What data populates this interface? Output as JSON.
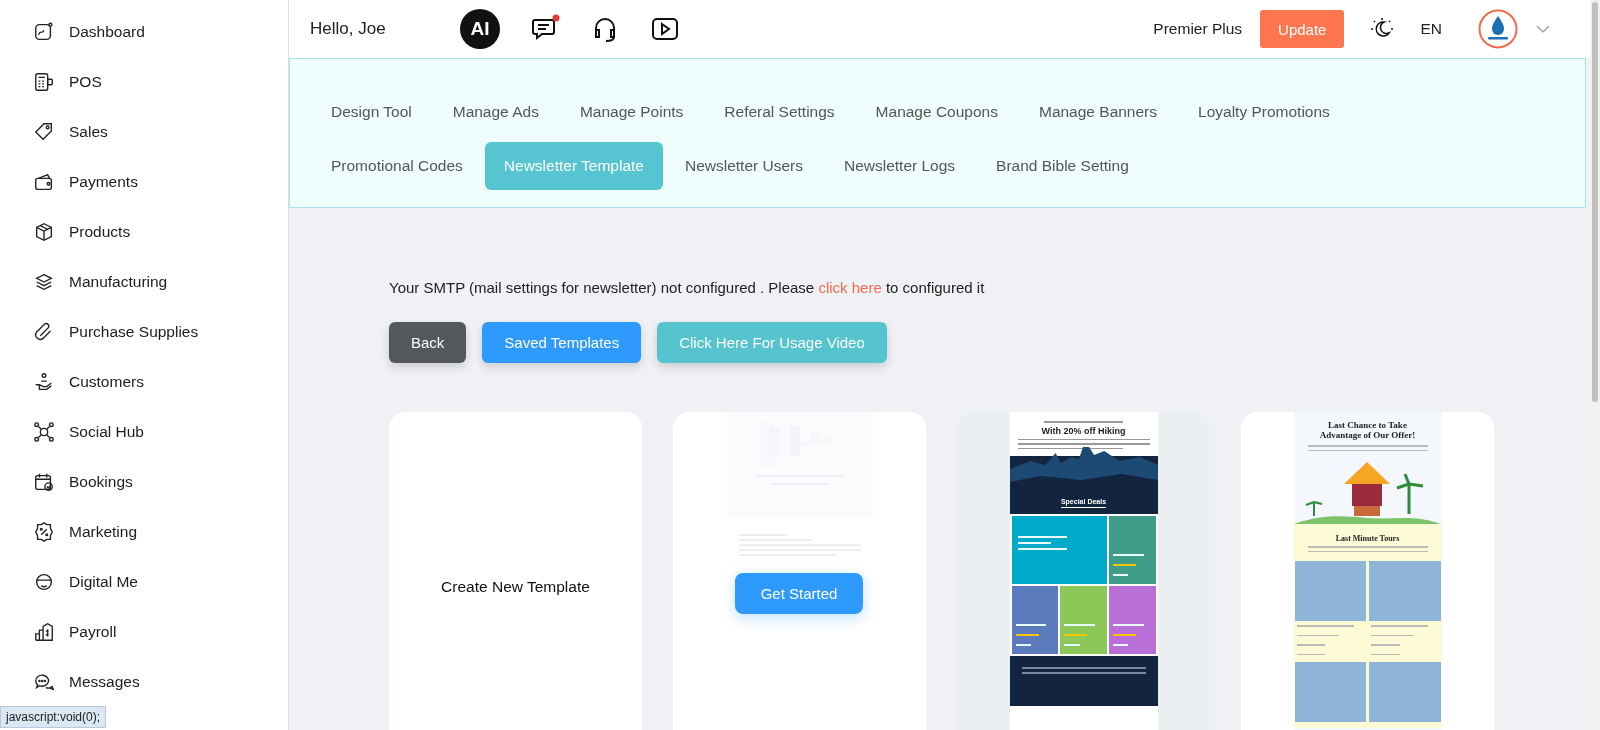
{
  "header": {
    "greeting": "Hello, Joe",
    "ai_badge": "AI",
    "chat_unread": true,
    "plan": "Premier Plus",
    "update_button": "Update",
    "language": "EN"
  },
  "sidebar": {
    "items": [
      {
        "label": "Dashboard"
      },
      {
        "label": "POS"
      },
      {
        "label": "Sales"
      },
      {
        "label": "Payments"
      },
      {
        "label": "Products"
      },
      {
        "label": "Manufacturing"
      },
      {
        "label": "Purchase Supplies"
      },
      {
        "label": "Customers"
      },
      {
        "label": "Social Hub"
      },
      {
        "label": "Bookings"
      },
      {
        "label": "Marketing"
      },
      {
        "label": "Digital Me"
      },
      {
        "label": "Payroll"
      },
      {
        "label": "Messages"
      }
    ]
  },
  "tabs": [
    {
      "label": "Design Tool",
      "selected": false
    },
    {
      "label": "Manage Ads",
      "selected": false
    },
    {
      "label": "Manage Points",
      "selected": false
    },
    {
      "label": "Referal Settings",
      "selected": false
    },
    {
      "label": "Manage Coupons",
      "selected": false
    },
    {
      "label": "Manage Banners",
      "selected": false
    },
    {
      "label": "Loyalty Promotions",
      "selected": false
    },
    {
      "label": "Promotional Codes",
      "selected": false
    },
    {
      "label": "Newsletter Template",
      "selected": true
    },
    {
      "label": "Newsletter Users",
      "selected": false
    },
    {
      "label": "Newsletter Logs",
      "selected": false
    },
    {
      "label": "Brand Bible Setting",
      "selected": false
    }
  ],
  "notice": {
    "before": "Your SMTP (mail settings for newsletter) not configured . Please ",
    "link": "click here",
    "after": " to configured it"
  },
  "buttons": [
    {
      "label": "Back",
      "kind": "dark"
    },
    {
      "label": "Saved Templates",
      "kind": "primary"
    },
    {
      "label": "Click Here For Usage Video",
      "kind": "info"
    }
  ],
  "templates": [
    {
      "kind": "create",
      "label": "Create New Template"
    },
    {
      "kind": "letter",
      "button": "Get Started"
    },
    {
      "kind": "hiking",
      "headline": "With 20% off Hiking",
      "section": "Special Deals",
      "products": [
        {
          "color": "#3e9c88"
        },
        {
          "color": "#5b7bbd"
        },
        {
          "color": "#8cc858"
        },
        {
          "color": "#b96ed8"
        }
      ]
    },
    {
      "kind": "tours",
      "headline": "Last Chance to Take Advantage of Our Offer!",
      "section": "Last Minute Tours"
    }
  ],
  "status_tooltip": "javascript:void(0);"
}
